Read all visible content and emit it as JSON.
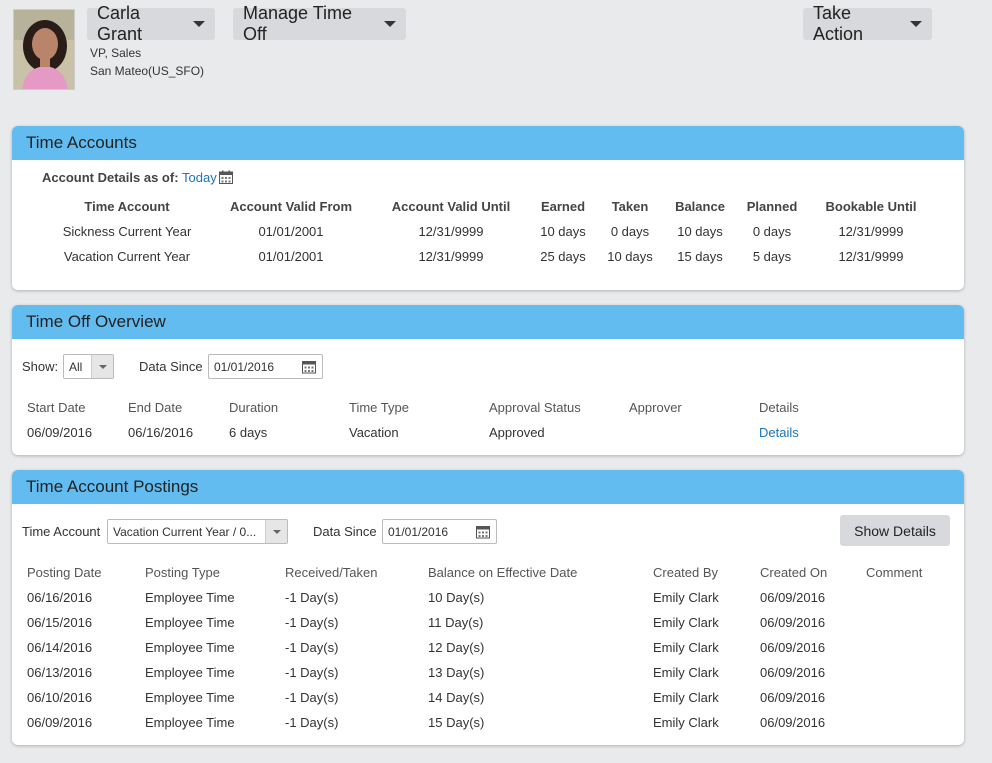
{
  "header": {
    "person_name": "Carla Grant",
    "job_title": "VP, Sales",
    "location": "San Mateo(US_SFO)",
    "manage_label": "Manage Time Off",
    "action_label": "Take Action"
  },
  "time_accounts": {
    "title": "Time Accounts",
    "as_of_label": "Account Details as of:",
    "as_of_value": "Today",
    "columns": [
      "Time Account",
      "Account Valid From",
      "Account Valid Until",
      "Earned",
      "Taken",
      "Balance",
      "Planned",
      "Bookable Until"
    ],
    "rows": [
      [
        "Sickness Current Year",
        "01/01/2001",
        "12/31/9999",
        "10 days",
        "0 days",
        "10 days",
        "0 days",
        "12/31/9999"
      ],
      [
        "Vacation Current Year",
        "01/01/2001",
        "12/31/9999",
        "25 days",
        "10 days",
        "15 days",
        "5 days",
        "12/31/9999"
      ]
    ]
  },
  "time_off_overview": {
    "title": "Time Off Overview",
    "show_label": "Show:",
    "show_value": "All",
    "data_since_label": "Data Since",
    "data_since_value": "01/01/2016",
    "columns": [
      "Start Date",
      "End Date",
      "Duration",
      "Time Type",
      "Approval Status",
      "Approver",
      "Details"
    ],
    "rows": [
      [
        "06/09/2016",
        "06/16/2016",
        "6 days",
        "Vacation",
        "Approved",
        "",
        "Details"
      ]
    ]
  },
  "postings": {
    "title": "Time Account Postings",
    "account_label": "Time Account",
    "account_value": "Vacation Current Year / 0...",
    "data_since_label": "Data Since",
    "data_since_value": "01/01/2016",
    "show_details_label": "Show Details",
    "columns": [
      "Posting Date",
      "Posting Type",
      "Received/Taken",
      "Balance on Effective Date",
      "Created By",
      "Created On",
      "Comment"
    ],
    "rows": [
      [
        "06/16/2016",
        "Employee Time",
        "-1 Day(s)",
        "10 Day(s)",
        "Emily Clark",
        "06/09/2016",
        ""
      ],
      [
        "06/15/2016",
        "Employee Time",
        "-1 Day(s)",
        "11 Day(s)",
        "Emily Clark",
        "06/09/2016",
        ""
      ],
      [
        "06/14/2016",
        "Employee Time",
        "-1 Day(s)",
        "12 Day(s)",
        "Emily Clark",
        "06/09/2016",
        ""
      ],
      [
        "06/13/2016",
        "Employee Time",
        "-1 Day(s)",
        "13 Day(s)",
        "Emily Clark",
        "06/09/2016",
        ""
      ],
      [
        "06/10/2016",
        "Employee Time",
        "-1 Day(s)",
        "14 Day(s)",
        "Emily Clark",
        "06/09/2016",
        ""
      ],
      [
        "06/09/2016",
        "Employee Time",
        "-1 Day(s)",
        "15 Day(s)",
        "Emily Clark",
        "06/09/2016",
        ""
      ]
    ]
  },
  "colors": {
    "panel_header": "#62bcf0",
    "link": "#1b75bb",
    "page_bg": "#e9eaec"
  }
}
